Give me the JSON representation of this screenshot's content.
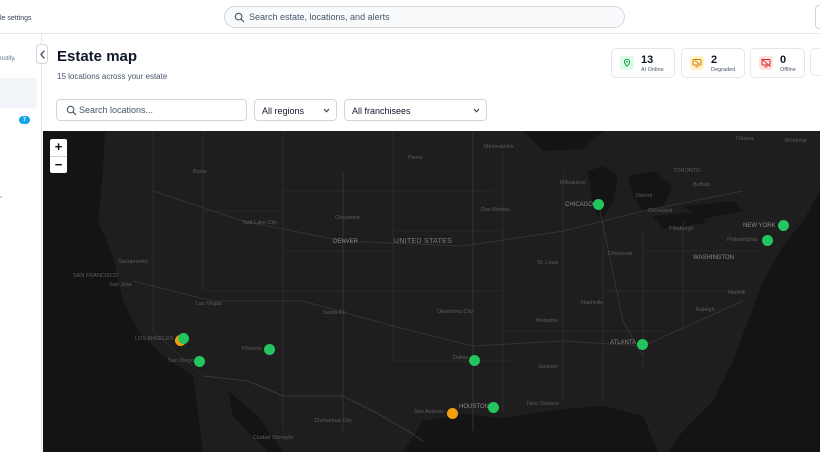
{
  "topbar": {
    "crumb_fragment": "le settings",
    "search_placeholder": "Search estate, locations, and alerts"
  },
  "sidebar": {
    "text_fragment": "notify,",
    "badge_count": "7"
  },
  "header": {
    "title": "Estate map",
    "subtitle": "15 locations across your estate"
  },
  "stats": [
    {
      "value": "13",
      "label": "AI Online",
      "icon": "map-pin-icon",
      "color": "#16a34a",
      "bg": "#dcfce7"
    },
    {
      "value": "2",
      "label": "Degraded",
      "icon": "monitor-warning-icon",
      "color": "#d97706",
      "bg": "#fef3c7"
    },
    {
      "value": "0",
      "label": "Offline",
      "icon": "monitor-off-icon",
      "color": "#dc2626",
      "bg": "#fee2e2"
    }
  ],
  "filters": {
    "search_placeholder": "Search locations...",
    "region_value": "All regions",
    "franchisee_value": "All franchisees"
  },
  "map": {
    "zoom_in": "+",
    "zoom_out": "−",
    "status_colors": {
      "online": "#22c55e",
      "degraded": "#f59e0b"
    },
    "labels": {
      "minneapolis": "Minneapolis",
      "ottawa": "Ottawa",
      "montreal": "Montréal",
      "toronto": "TORONTO",
      "buffalo": "Buffalo",
      "detroit": "Detroit",
      "milwaukee": "Milwaukee",
      "chicago": "CHICAGO",
      "cleveland": "Cleveland",
      "pittsburgh": "Pittsburgh",
      "new_york": "NEW YORK",
      "philadelphia": "Philadelphia",
      "washington": "WASHINGTON",
      "norfolk": "Norfolk",
      "des_moines": "Des Moines",
      "pierre": "Pierre",
      "boise": "Boise",
      "salt_lake": "Salt Lake City",
      "cheyenne": "Cheyenne",
      "denver": "DENVER",
      "united_states": "UNITED STATES",
      "sacramento": "Sacramento",
      "san_francisco": "SAN FRANCISCO",
      "san_jose": "San Jose",
      "las_vegas": "Las Vegas",
      "santa_fe": "Santa Fe",
      "oklahoma": "Oklahoma City",
      "st_louis": "St. Louis",
      "cincinnati": "Cincinnati",
      "nashville": "Nashville",
      "memphis": "Memphis",
      "raleigh": "Raleigh",
      "los_angeles": "LOS ANGELES",
      "san_diego": "San Diego",
      "phoenix": "Phoenix",
      "dallas": "Dallas",
      "atlanta": "ATLANTA",
      "jackson": "Jackson",
      "san_antonio": "San Antonio",
      "houston": "HOUSTON",
      "new_orleans": "New Orleans",
      "chihuahua": "Chihuahua City",
      "ciudad": "Ciudad Obregón"
    },
    "locations": [
      {
        "name": "chicago",
        "status": "online"
      },
      {
        "name": "new-york",
        "status": "online"
      },
      {
        "name": "philadelphia",
        "status": "online"
      },
      {
        "name": "los-angeles",
        "status": "degraded"
      },
      {
        "name": "los-angeles-2",
        "status": "online"
      },
      {
        "name": "san-diego",
        "status": "online"
      },
      {
        "name": "phoenix",
        "status": "online"
      },
      {
        "name": "dallas",
        "status": "online"
      },
      {
        "name": "atlanta",
        "status": "online"
      },
      {
        "name": "san-antonio",
        "status": "degraded"
      },
      {
        "name": "houston",
        "status": "online"
      }
    ]
  }
}
